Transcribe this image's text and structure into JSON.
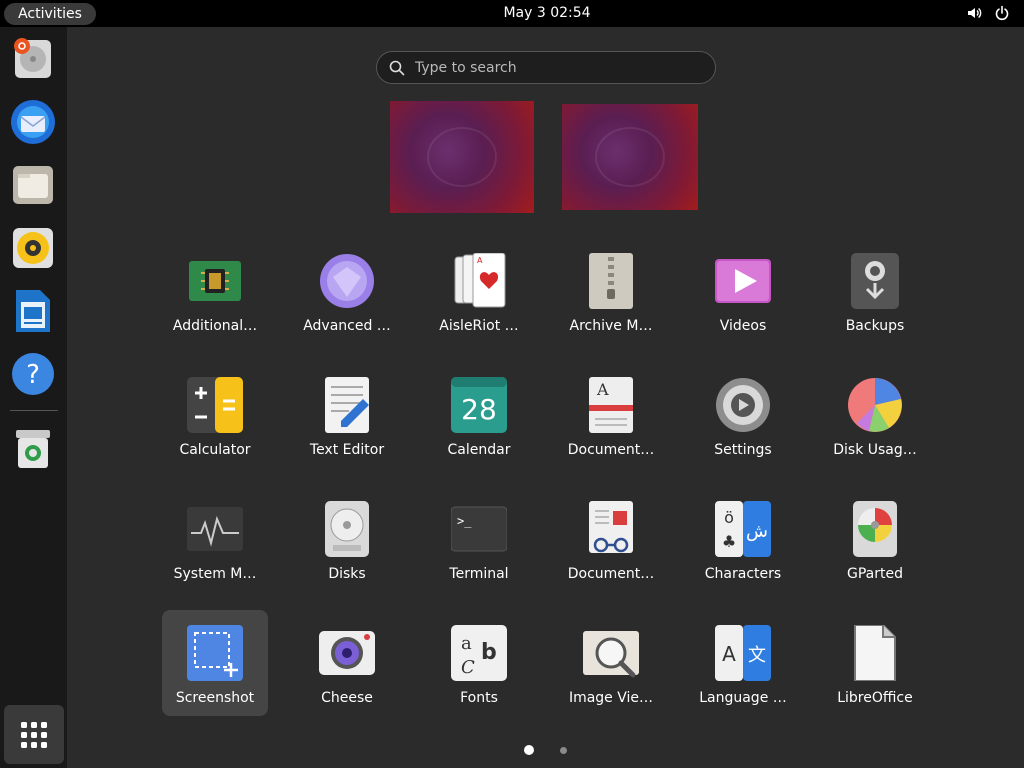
{
  "topbar": {
    "activities_label": "Activities",
    "clock": "May 3  02:54",
    "tray_icons": [
      "volume-icon",
      "power-icon"
    ]
  },
  "dock": {
    "items": [
      {
        "name": "ubuntu-installer",
        "icon": "installer-disc-icon"
      },
      {
        "name": "thunderbird",
        "icon": "mail-icon"
      },
      {
        "name": "files",
        "icon": "folder-icon"
      },
      {
        "name": "rhythmbox",
        "icon": "music-icon"
      },
      {
        "name": "libreoffice-writer",
        "icon": "writer-icon"
      },
      {
        "name": "help",
        "icon": "help-icon"
      },
      {
        "name": "trash",
        "icon": "trash-icon"
      }
    ],
    "show_apps_icon": "grid-icon"
  },
  "search": {
    "placeholder": "Type to search"
  },
  "apps": [
    {
      "label": "Additional…",
      "icon": "chip-icon"
    },
    {
      "label": "Advanced …",
      "icon": "gem-icon"
    },
    {
      "label": "AisleRiot …",
      "icon": "cards-icon"
    },
    {
      "label": "Archive M…",
      "icon": "zip-icon"
    },
    {
      "label": "Videos",
      "icon": "video-icon"
    },
    {
      "label": "Backups",
      "icon": "backup-icon"
    },
    {
      "label": "Calculator",
      "icon": "calculator-icon"
    },
    {
      "label": "Text Editor",
      "icon": "text-editor-icon"
    },
    {
      "label": "Calendar",
      "icon": "calendar-icon",
      "text": "28"
    },
    {
      "label": "Document…",
      "icon": "document-scanner-icon"
    },
    {
      "label": "Settings",
      "icon": "settings-gear-icon"
    },
    {
      "label": "Disk Usag…",
      "icon": "pie-icon"
    },
    {
      "label": "System M…",
      "icon": "system-monitor-icon"
    },
    {
      "label": "Disks",
      "icon": "disks-icon"
    },
    {
      "label": "Terminal",
      "icon": "terminal-icon",
      "text": ">_"
    },
    {
      "label": "Document…",
      "icon": "document-viewer-icon"
    },
    {
      "label": "Characters",
      "icon": "characters-icon",
      "text": "ö ش"
    },
    {
      "label": "GParted",
      "icon": "gparted-icon"
    },
    {
      "label": "Screenshot",
      "icon": "screenshot-icon",
      "selected": true
    },
    {
      "label": "Cheese",
      "icon": "camera-icon"
    },
    {
      "label": "Fonts",
      "icon": "fonts-icon",
      "text": "a b c"
    },
    {
      "label": "Image Vie…",
      "icon": "image-viewer-icon"
    },
    {
      "label": "Language …",
      "icon": "language-icon",
      "text": "A 文"
    },
    {
      "label": "LibreOffice",
      "icon": "libreoffice-icon"
    }
  ],
  "pagination": {
    "pages": 2,
    "current": 1
  },
  "colors": {
    "accent": "#e95420",
    "panel": "#000000",
    "background": "#2b2b2b"
  }
}
